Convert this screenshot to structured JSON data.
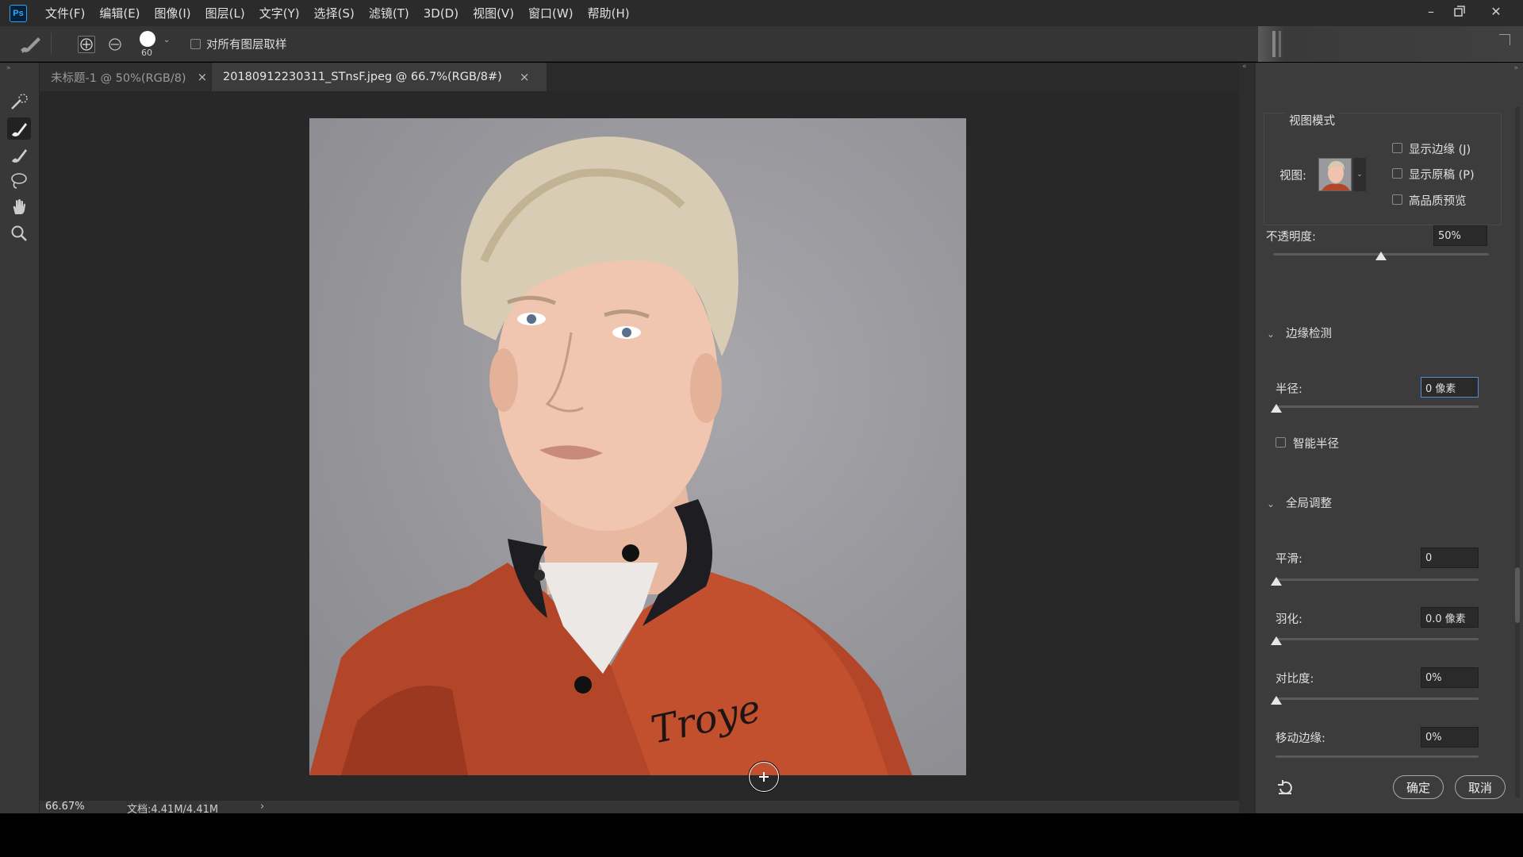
{
  "app": {
    "logo": "Ps"
  },
  "menu": [
    "文件(F)",
    "编辑(E)",
    "图像(I)",
    "图层(L)",
    "文字(Y)",
    "选择(S)",
    "滤镜(T)",
    "3D(D)",
    "视图(V)",
    "窗口(W)",
    "帮助(H)"
  ],
  "options": {
    "brush_size": "60",
    "sample_all_layers": "对所有图层取样"
  },
  "tabs": [
    {
      "label": "未标题-1 @ 50%(RGB/8)",
      "active": false
    },
    {
      "label": "20180912230311_STnsF.jpeg @ 66.7%(RGB/8#)",
      "active": true
    }
  ],
  "status": {
    "zoom": "66.67%",
    "doc": "文档:4.41M/4.41M",
    "arrow": "›"
  },
  "panel": {
    "view_mode_header": "视图模式",
    "view_label": "视图:",
    "show_edge": "显示边缘 (J)",
    "show_original": "显示原稿 (P)",
    "hq_preview": "高品质预览",
    "opacity_label": "不透明度:",
    "opacity_value": "50%",
    "opacity_level": 0.5,
    "edge_section": "边缘检测",
    "radius_label": "半径:",
    "radius_value": "0 像素",
    "smart_radius": "智能半径",
    "global_section": "全局调整",
    "smooth_label": "平滑:",
    "smooth_value": "0",
    "feather_label": "羽化:",
    "feather_value": "0.0 像素",
    "contrast_label": "对比度:",
    "contrast_value": "0%",
    "shift_edge_label": "移动边缘:",
    "shift_edge_value": "0%",
    "ok": "确定",
    "cancel": "取消"
  },
  "photo": {
    "jacket_text": "Troye"
  },
  "colors": {
    "accent": "#31a8ff",
    "jacket": "#b84a2c",
    "background": "#98979c"
  }
}
